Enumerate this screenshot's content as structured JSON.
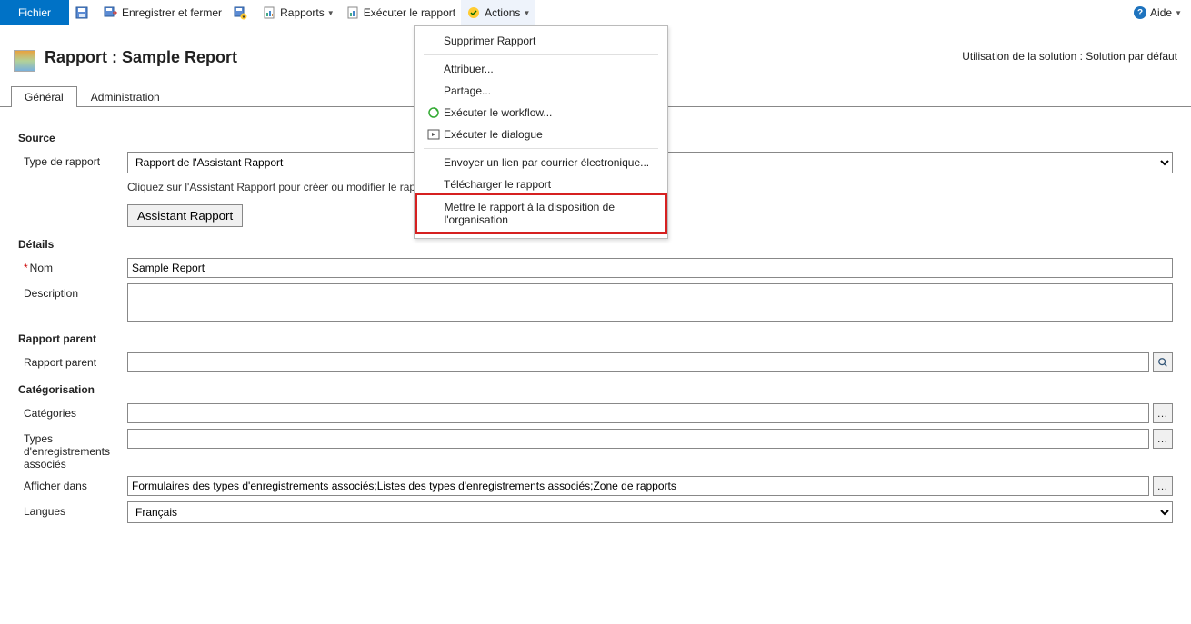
{
  "toolbar": {
    "file": "Fichier",
    "save_close": "Enregistrer et fermer",
    "reports": "Rapports",
    "run_report": "Exécuter le rapport",
    "actions": "Actions",
    "help": "Aide"
  },
  "header": {
    "title": "Rapport : Sample Report",
    "solution_label": "Utilisation de la solution : Solution par défaut"
  },
  "tabs": {
    "general": "Général",
    "admin": "Administration"
  },
  "menu": {
    "delete": "Supprimer Rapport",
    "assign": "Attribuer...",
    "share": "Partage...",
    "workflow": "Exécuter le workflow...",
    "dialog": "Exécuter le dialogue",
    "email": "Envoyer un lien par courrier électronique...",
    "download": "Télécharger le rapport",
    "make_org": "Mettre le rapport à la disposition de l'organisation"
  },
  "form": {
    "source_section": "Source",
    "type_label": "Type de rapport",
    "type_value": "Rapport de l'Assistant Rapport",
    "hint": "Cliquez sur l'Assistant Rapport pour créer ou modifier le rapport.",
    "wizard_btn": "Assistant Rapport",
    "details_section": "Détails",
    "name_label": "Nom",
    "name_value": "Sample Report",
    "desc_label": "Description",
    "desc_value": "",
    "parent_section": "Rapport parent",
    "parent_label": "Rapport parent",
    "parent_value": "",
    "cat_section": "Catégorisation",
    "categories_label": "Catégories",
    "categories_value": "",
    "types_label": "Types d'enregistrements associés",
    "types_value": "",
    "show_label": "Afficher dans",
    "show_value": "Formulaires des types d'enregistrements associés;Listes des types d'enregistrements associés;Zone de rapports",
    "lang_label": "Langues",
    "lang_value": "Français"
  }
}
